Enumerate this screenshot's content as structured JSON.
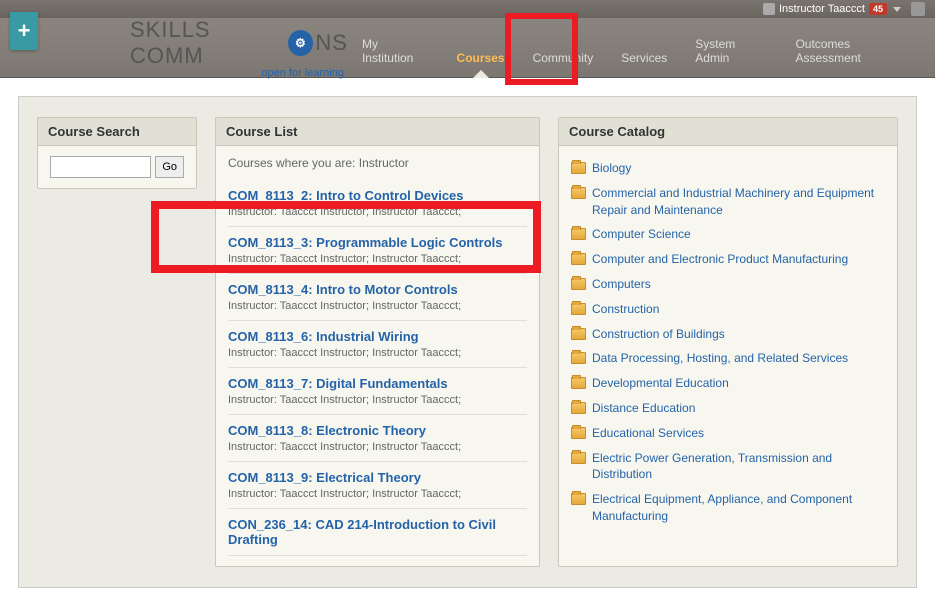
{
  "topbar": {
    "username": "Instructor Taaccct",
    "badge": "45"
  },
  "logo": {
    "pre": "SKILLS COMM",
    "post": "NS",
    "tagline": "open for learning"
  },
  "nav": {
    "items": [
      {
        "label": "My Institution",
        "active": false
      },
      {
        "label": "Courses",
        "active": true
      },
      {
        "label": "Community",
        "active": false
      },
      {
        "label": "Services",
        "active": false
      },
      {
        "label": "System Admin",
        "active": false
      },
      {
        "label": "Outcomes Assessment",
        "active": false
      }
    ]
  },
  "search": {
    "title": "Course Search",
    "go": "Go"
  },
  "course_list": {
    "title": "Course List",
    "intro": "Courses where you are: Instructor",
    "items": [
      {
        "title": "COM_8113_2: Intro to Control Devices",
        "meta": "Instructor: Taaccct Instructor;  Instructor Taaccct;"
      },
      {
        "title": "COM_8113_3: Programmable Logic Controls",
        "meta": "Instructor: Taaccct Instructor;  Instructor Taaccct;"
      },
      {
        "title": "COM_8113_4: Intro to Motor Controls",
        "meta": "Instructor: Taaccct Instructor;  Instructor Taaccct;"
      },
      {
        "title": "COM_8113_6: Industrial Wiring",
        "meta": "Instructor: Taaccct Instructor;  Instructor Taaccct;"
      },
      {
        "title": "COM_8113_7: Digital Fundamentals",
        "meta": "Instructor: Taaccct Instructor;  Instructor Taaccct;"
      },
      {
        "title": "COM_8113_8: Electronic Theory",
        "meta": "Instructor: Taaccct Instructor;  Instructor Taaccct;"
      },
      {
        "title": "COM_8113_9: Electrical Theory",
        "meta": "Instructor: Taaccct Instructor;  Instructor Taaccct;"
      },
      {
        "title": "CON_236_14: CAD 214-Introduction to Civil Drafting",
        "meta": ""
      }
    ]
  },
  "catalog": {
    "title": "Course Catalog",
    "items": [
      "Biology",
      "Commercial and Industrial Machinery and Equipment Repair and Maintenance",
      "Computer Science",
      "Computer and Electronic Product Manufacturing",
      "Computers",
      "Construction",
      "Construction of Buildings",
      "Data Processing, Hosting, and Related Services",
      "Developmental Education",
      "Distance Education",
      "Educational Services",
      "Electric Power Generation, Transmission and Distribution",
      "Electrical Equipment, Appliance, and Component Manufacturing"
    ]
  }
}
